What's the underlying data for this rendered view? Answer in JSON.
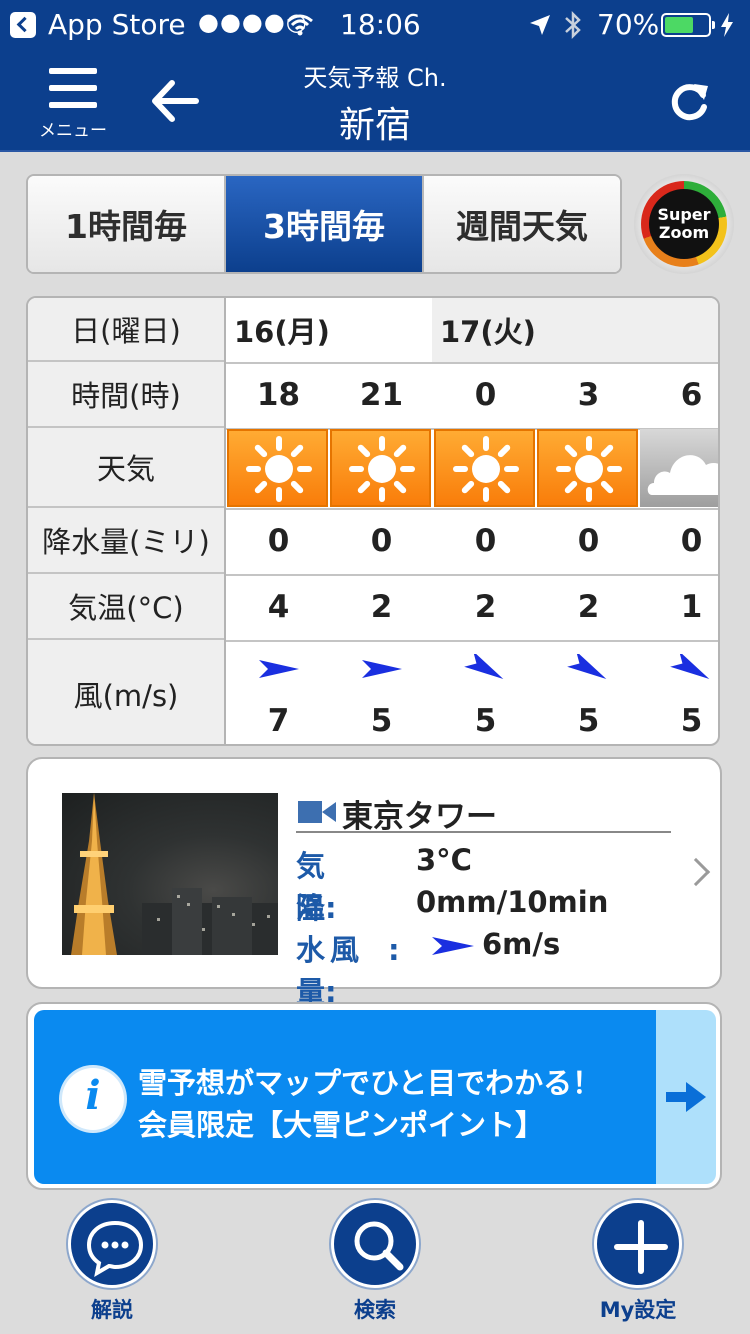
{
  "status_bar": {
    "back_app": "App Store",
    "signal": "●●●●○",
    "wifi_icon": "wifi-icon",
    "time": "18:06",
    "location_icon": "location-arrow-icon",
    "bluetooth_icon": "bluetooth-icon",
    "battery_percent": "70%",
    "battery_level": 0.7
  },
  "navbar": {
    "menu_label": "メニュー",
    "title": "天気予報 Ch.",
    "subtitle": "新宿"
  },
  "tabs": [
    {
      "label": "1時間毎",
      "active": false
    },
    {
      "label": "3時間毎",
      "active": true
    },
    {
      "label": "週間天気",
      "active": false
    }
  ],
  "super_zoom": {
    "line1": "Super",
    "line2": "Zoom"
  },
  "forecast": {
    "row_labels": {
      "date": "日(曜日)",
      "hour": "時間(時)",
      "weather": "天気",
      "precip": "降水量(ミリ)",
      "temp": "気温(°C)",
      "wind": "風(m/s)"
    },
    "dates": [
      "16(月)",
      "17(火)"
    ],
    "hours": [
      "18",
      "21",
      "0",
      "3",
      "6"
    ],
    "weather": [
      "sunny",
      "sunny",
      "sunny",
      "sunny",
      "cloudy"
    ],
    "precip": [
      "0",
      "0",
      "0",
      "0",
      "0"
    ],
    "temp": [
      "4",
      "2",
      "2",
      "2",
      "1"
    ],
    "wind_dir": [
      "east",
      "east",
      "southeast",
      "southeast",
      "southeast"
    ],
    "wind_speed": [
      "7",
      "5",
      "5",
      "5",
      "5"
    ]
  },
  "camera": {
    "title": "東京タワー",
    "temp_label": "気　温:",
    "temp_value": "3°C",
    "precip_label": "降水量:",
    "precip_value": "0mm/10min",
    "wind_label": "風　:",
    "wind_value": "6m/s"
  },
  "banner": {
    "line1": "雪予想がマップでひと目でわかる！",
    "line2": "会員限定【大雪ピンポイント】"
  },
  "toolbar": {
    "explain": "解説",
    "search": "検索",
    "settings": "My設定"
  },
  "colors": {
    "navy": "#0c3f8d",
    "sunny": "#f98a10",
    "banner_blue": "#0a8af0",
    "arrow_blue": "#1a2fe0"
  }
}
